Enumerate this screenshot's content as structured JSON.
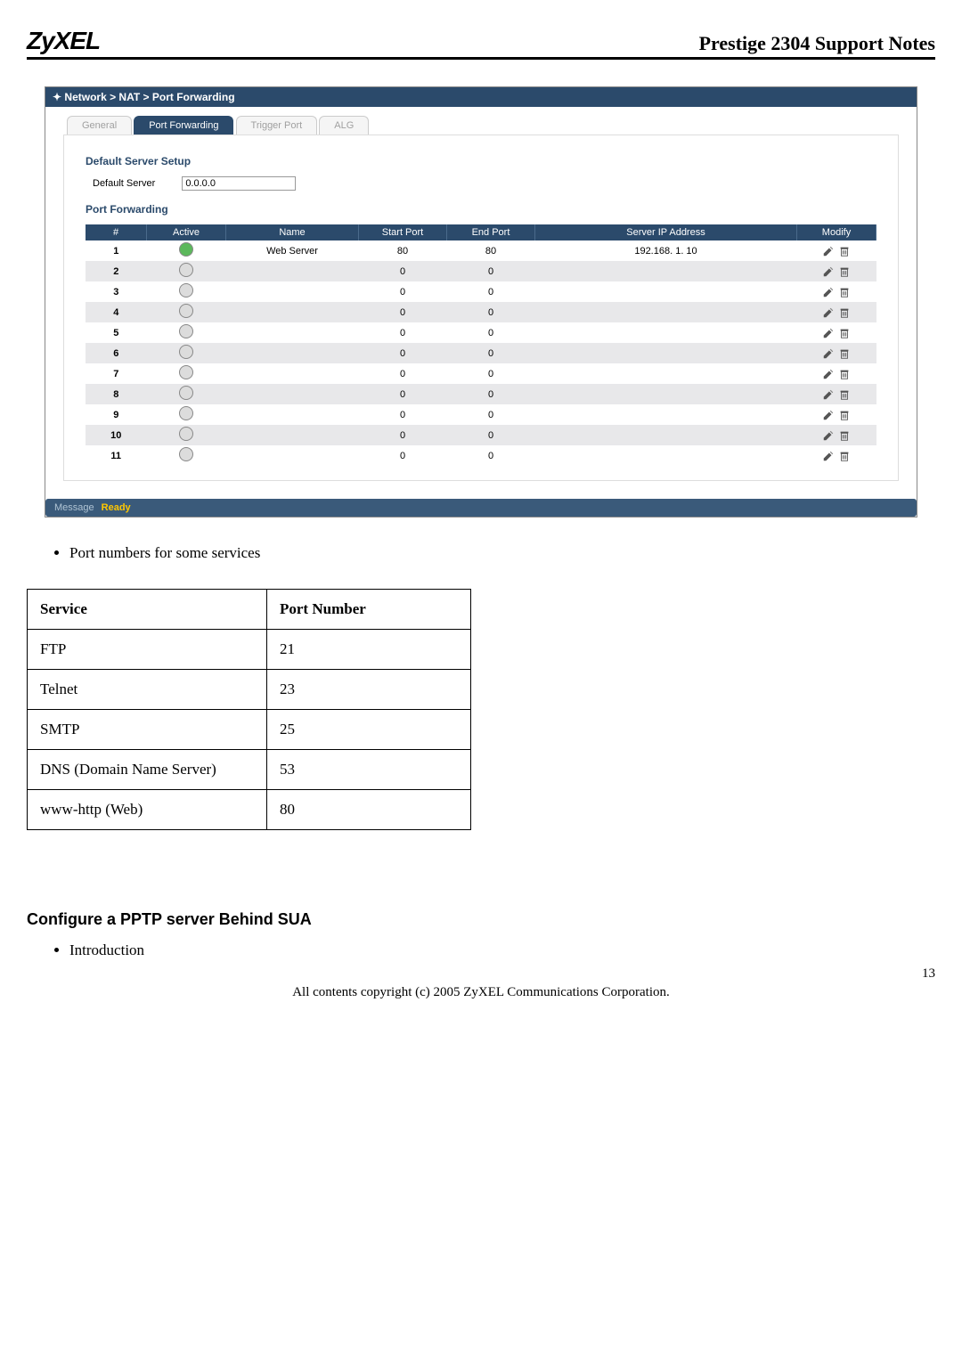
{
  "header": {
    "logo": "ZyXEL",
    "title": "Prestige 2304 Support Notes"
  },
  "router": {
    "breadcrumb": "Network > NAT > Port Forwarding",
    "tabs": [
      "General",
      "Port Forwarding",
      "Trigger Port",
      "ALG"
    ],
    "active_tab": 1,
    "default_server_hdr": "Default Server Setup",
    "default_server_label": "Default Server",
    "default_server_value": "0.0.0.0",
    "pf_hdr": "Port Forwarding",
    "columns": [
      "#",
      "Active",
      "Name",
      "Start Port",
      "End Port",
      "Server IP Address",
      "Modify"
    ],
    "rows": [
      {
        "n": "1",
        "active": true,
        "name": "Web Server",
        "start": "80",
        "end": "80",
        "ip": "192.168. 1. 10"
      },
      {
        "n": "2",
        "active": false,
        "name": "",
        "start": "0",
        "end": "0",
        "ip": ""
      },
      {
        "n": "3",
        "active": false,
        "name": "",
        "start": "0",
        "end": "0",
        "ip": ""
      },
      {
        "n": "4",
        "active": false,
        "name": "",
        "start": "0",
        "end": "0",
        "ip": ""
      },
      {
        "n": "5",
        "active": false,
        "name": "",
        "start": "0",
        "end": "0",
        "ip": ""
      },
      {
        "n": "6",
        "active": false,
        "name": "",
        "start": "0",
        "end": "0",
        "ip": ""
      },
      {
        "n": "7",
        "active": false,
        "name": "",
        "start": "0",
        "end": "0",
        "ip": ""
      },
      {
        "n": "8",
        "active": false,
        "name": "",
        "start": "0",
        "end": "0",
        "ip": ""
      },
      {
        "n": "9",
        "active": false,
        "name": "",
        "start": "0",
        "end": "0",
        "ip": ""
      },
      {
        "n": "10",
        "active": false,
        "name": "",
        "start": "0",
        "end": "0",
        "ip": ""
      },
      {
        "n": "11",
        "active": false,
        "name": "",
        "start": "0",
        "end": "0",
        "ip": ""
      }
    ],
    "message_label": "Message",
    "message_value": "Ready"
  },
  "bullet1": "Port numbers for some services",
  "services": {
    "headers": [
      "Service",
      "Port Number"
    ],
    "rows": [
      {
        "s": "FTP",
        "p": "21"
      },
      {
        "s": "Telnet",
        "p": "23"
      },
      {
        "s": "SMTP",
        "p": "25"
      },
      {
        "s": "DNS (Domain Name Server)",
        "p": "53"
      },
      {
        "s": "www-http (Web)",
        "p": "80"
      }
    ]
  },
  "heading2": "Configure a PPTP server Behind SUA",
  "bullet2": "Introduction",
  "page_number": "13",
  "copyright": "All contents copyright (c) 2005 ZyXEL Communications Corporation."
}
